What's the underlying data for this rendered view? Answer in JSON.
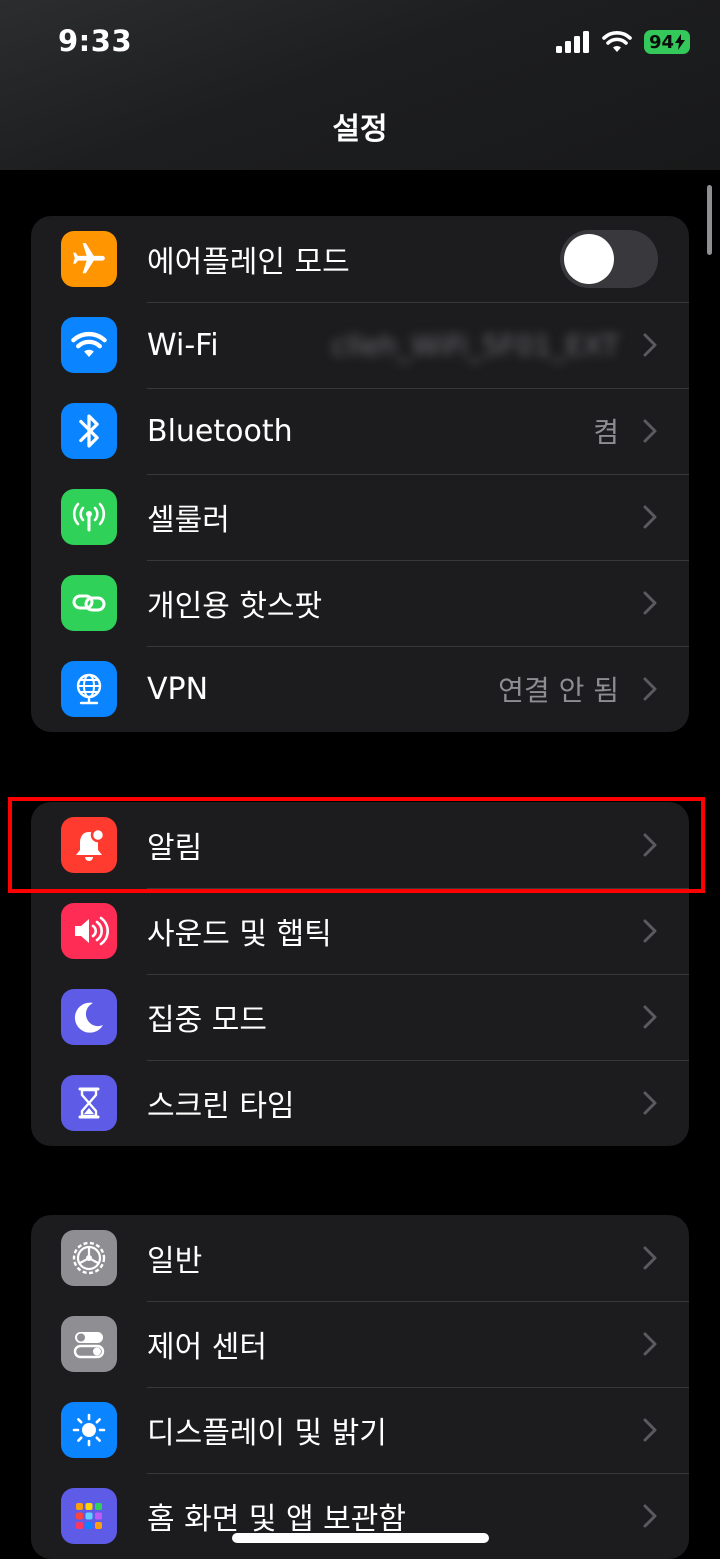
{
  "status_bar": {
    "time": "9:33",
    "battery": "94",
    "icons": [
      "signal-icon",
      "wifi-icon",
      "battery-charging-icon"
    ]
  },
  "nav": {
    "title": "설정"
  },
  "groups": [
    {
      "rows": [
        {
          "label": "에어플레인 모드",
          "icon": "airplane-icon",
          "icon_color": "#ff9500",
          "toggle": "off"
        },
        {
          "label": "Wi-Fi",
          "icon": "wifi-icon",
          "icon_color": "#0a84ff",
          "value": "clleh_WiFi_5F01_EXT"
        },
        {
          "label": "Bluetooth",
          "icon": "bluetooth-icon",
          "icon_color": "#0a84ff",
          "value": "켬"
        },
        {
          "label": "셀룰러",
          "icon": "cellular-antenna-icon",
          "icon_color": "#30d158"
        },
        {
          "label": "개인용 핫스팟",
          "icon": "hotspot-link-icon",
          "icon_color": "#30d158"
        },
        {
          "label": "VPN",
          "icon": "vpn-globe-icon",
          "icon_color": "#0a84ff",
          "value": "연결 안 됨"
        }
      ]
    },
    {
      "rows": [
        {
          "label": "알림",
          "icon": "bell-icon",
          "icon_color": "#ff3b30",
          "highlighted": true
        },
        {
          "label": "사운드 및 햅틱",
          "icon": "speaker-icon",
          "icon_color": "#ff2d55"
        },
        {
          "label": "집중 모드",
          "icon": "moon-icon",
          "icon_color": "#5e5ce6"
        },
        {
          "label": "스크린 타임",
          "icon": "hourglass-icon",
          "icon_color": "#5e5ce6"
        }
      ]
    },
    {
      "rows": [
        {
          "label": "일반",
          "icon": "gear-icon",
          "icon_color": "#8e8e93"
        },
        {
          "label": "제어 센터",
          "icon": "switches-icon",
          "icon_color": "#8e8e93"
        },
        {
          "label": "디스플레이 및 밝기",
          "icon": "sun-icon",
          "icon_color": "#0a84ff"
        },
        {
          "label": "홈 화면 및 앱 보관함",
          "icon": "app-grid-icon",
          "icon_color": "#5e5ce6"
        }
      ]
    }
  ]
}
